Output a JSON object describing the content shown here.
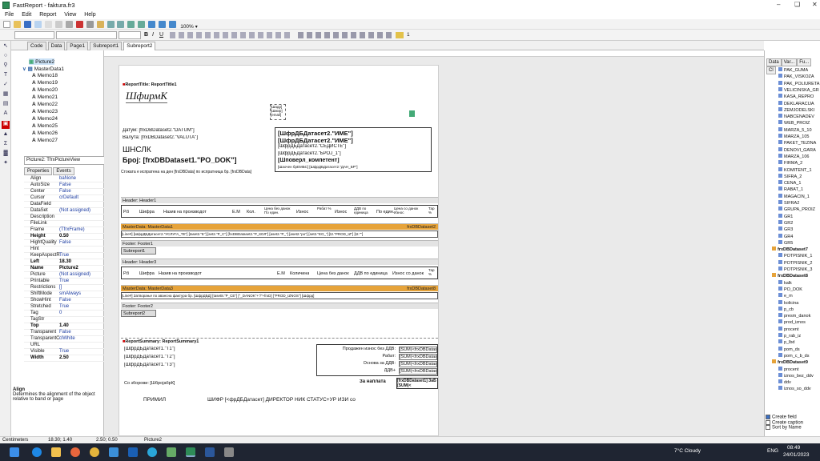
{
  "app": {
    "title": "FastReport - faktura.fr3"
  },
  "menu": [
    "File",
    "Edit",
    "Report",
    "View",
    "Help"
  ],
  "toolbar": {
    "zoom": "100%",
    "font_size": "1"
  },
  "tabs": [
    "Code",
    "Data",
    "Page1",
    "Subreport1",
    "Subreport2"
  ],
  "tree": [
    {
      "label": "Picture2",
      "sel": true
    },
    {
      "label": "MasterData1"
    },
    {
      "label": "Memo18"
    },
    {
      "label": "Memo19"
    },
    {
      "label": "Memo20"
    },
    {
      "label": "Memo21"
    },
    {
      "label": "Memo22"
    },
    {
      "label": "Memo23"
    },
    {
      "label": "Memo24"
    },
    {
      "label": "Memo25"
    },
    {
      "label": "Memo26"
    },
    {
      "label": "Memo27"
    }
  ],
  "object_selector": "Picture2: TfrxPictureView",
  "prop_tabs": [
    "Properties",
    "Events"
  ],
  "props": [
    {
      "k": "Align",
      "v": "baNone"
    },
    {
      "k": "AutoSize",
      "v": "False"
    },
    {
      "k": "Center",
      "v": "False"
    },
    {
      "k": "Cursor",
      "v": "crDefault"
    },
    {
      "k": "DataField",
      "v": ""
    },
    {
      "k": "DataSet",
      "v": "(Not assigned)"
    },
    {
      "k": "Description",
      "v": ""
    },
    {
      "k": "FileLink",
      "v": ""
    },
    {
      "k": "Frame",
      "v": "(TfrxFrame)"
    },
    {
      "k": "Height",
      "v": "0.50",
      "b": true
    },
    {
      "k": "HightQuality",
      "v": "False"
    },
    {
      "k": "Hint",
      "v": ""
    },
    {
      "k": "KeepAspectR",
      "v": "True"
    },
    {
      "k": "Left",
      "v": "18.30",
      "b": true
    },
    {
      "k": "Name",
      "v": "Picture2",
      "b": true
    },
    {
      "k": "Picture",
      "v": "(Not assigned)"
    },
    {
      "k": "Printable",
      "v": "True"
    },
    {
      "k": "Restrictions",
      "v": "[]"
    },
    {
      "k": "ShiftMode",
      "v": "smAlways"
    },
    {
      "k": "ShowHint",
      "v": "False"
    },
    {
      "k": "Stretched",
      "v": "True"
    },
    {
      "k": "Tag",
      "v": "0"
    },
    {
      "k": "TagStr",
      "v": ""
    },
    {
      "k": "Top",
      "v": "1.40",
      "b": true
    },
    {
      "k": "Transparent",
      "v": "False"
    },
    {
      "k": "TransparentC",
      "v": "clWhite"
    },
    {
      "k": "URL",
      "v": ""
    },
    {
      "k": "Visible",
      "v": "True"
    },
    {
      "k": "Width",
      "v": "2.50",
      "b": true
    }
  ],
  "help": {
    "title": "Align",
    "text": "Determines the alignment of the object relative to band or page"
  },
  "report": {
    "report_title": "ReportTitle: ReportTitle1",
    "logo_text": "ШфирмК",
    "fields_box": "[Шадр] [Шжир] [email]",
    "datum": "Датум: [frxDBDataset2.\"DATUM\"]",
    "valuta": "Валута: [frxDBDataset2.\"VALUTA\"]",
    "shnclk": "ШНСЛК",
    "broj": "Број: [frxDBDataset1.\"PO_DOK\"]",
    "rt_box1": "[ШфрДБДатасет2.\"ИМЕ\"]",
    "rt_box2": "[ШфрДБДатасет2.\"ИМЕ\"]",
    "rt_box3": "[ШфрДБДатасет2.\"СЕДИСТЕ\"]",
    "rt_box4": "[ШфрДБДатасет2.\"БРОЈ_1\"]",
    "rt_box5": "[Шповерл_компетент]",
    "rt_box6": "[Шаочен брЕМБС]   [ШфрДБДатасет2.\"ДАН_БР\"]",
    "stokata": "Стоката е испратена на ден [frxDBData] по испратница бр. [frxDBData]",
    "header1": "Header: Header1",
    "cols1": [
      "Р.б",
      "Шифра",
      "Назив на производот",
      "Е.М",
      "Кол.",
      "Цена без данок По един.",
      "Износ",
      "Рабат %",
      "Износ",
      "ДДВ по единица",
      "По един.",
      "Цена со данок Износ",
      "Тар %"
    ],
    "masterdata1": "MasterData: MasterData1",
    "masterdata1_ds": "frxDBDataset2",
    "md1_row": "[Line#] [ШфрДБДатасет2.\"УСЛУГА_ТЕ\"] [taset2.\"Е\"] [set2.\"Р_С\"] [frxDBDataset2.\"Р_КОЛ\"] [aset2.\"Р_\"] [aset2.\"po\"] [set2.\"ЕО_\"] [t2.\"PROD_IZ\"] [t2.\"\"]",
    "footer1": "Footer: Footer1",
    "subreport1": "Subreport1",
    "header3": "Header: Header3",
    "cols3": [
      "Р.б",
      "Шифра",
      "Назив на производот",
      "Е.М",
      "Количина",
      "Цена без данок",
      "ДДВ по единица",
      "Износ со данок",
      "Тар %"
    ],
    "masterdata3": "MasterData: MasterData3",
    "masterdata3_ds": "frxDBDataset8",
    "md3_row": "[Line#]   Затворање по авансна фактура бр.   [ШфрДБД] [taset8.\"Р_СЕ\"]   [\"_DANOK\"+\"/\"+frxD]   [\"PROD_IZNOS\"]   [Шфрд]",
    "footer2": "Footer: Footer2",
    "subreport2": "Subreport2",
    "summary": "ReportSummary: ReportSummary1",
    "sum_l1": "[ШфрДБДатасет1.\"Т1\"]",
    "sum_l2": "[ШфрДБДатасет1.\"Т2\"]",
    "sum_l3": "[ШфрДБДатасет1.\"Т3\"]",
    "sum_r1": "Продажен износ без ДДВ:",
    "sum_r2": "Рабат:",
    "sum_r3": "Основа за ДДВ:",
    "sum_r4": "ДДВ+",
    "sum_v1": "[SUM(<frxDBDatas",
    "sum_v2": "[SUM(<frxDBDatas",
    "sum_v3": "[SUM(<frxDBDatas",
    "sum_v4": "[SUM(<frxDBDatas",
    "za_naplata": "За наплата",
    "naplata_val": "[frxDBDataset1] ЗаБ [SUM(<",
    "so_zborovi": "Со зборови: [ШбројабрК]",
    "primil": "ПРИМИЛ",
    "footer_line": "ШИФР [<фрДБДатасет]  ДИРЕКТОР НИК СТАТУС+УР ИЗИ со"
  },
  "right_panel": {
    "tabs": [
      "Data",
      "Var...",
      "Fu...",
      "Cl"
    ],
    "items": [
      {
        "t": "PAK_GUMA"
      },
      {
        "t": "PAK_VISKOZA"
      },
      {
        "t": "PAK_POLIURETA"
      },
      {
        "t": "VELICINSKA_GR"
      },
      {
        "t": "KASA_REPRO"
      },
      {
        "t": "DEKLARACIJA"
      },
      {
        "t": "ZEMJODELSKI"
      },
      {
        "t": "NABCENADEV"
      },
      {
        "t": "WEB_PROIZ"
      },
      {
        "t": "MARZA_5_10"
      },
      {
        "t": "MARZA_105"
      },
      {
        "t": "PAKET_TEZINA"
      },
      {
        "t": "DENOVI_GARA"
      },
      {
        "t": "MARZA_106"
      },
      {
        "t": "FIRMA_2"
      },
      {
        "t": "KOMITENT_1"
      },
      {
        "t": "SIFRA_2"
      },
      {
        "t": "CENA_1"
      },
      {
        "t": "RABAT_1"
      },
      {
        "t": "MAGACIN_1"
      },
      {
        "t": "SIFRA2"
      },
      {
        "t": "GRUPA_PROIZ"
      },
      {
        "t": "GR1"
      },
      {
        "t": "GR2"
      },
      {
        "t": "GR3"
      },
      {
        "t": "GR4"
      },
      {
        "t": "GR5"
      },
      {
        "t": "frxDBDataset7",
        "ds": true
      },
      {
        "t": "POTPISNIK_1"
      },
      {
        "t": "POTPISNIK_2"
      },
      {
        "t": "POTPISNIK_3"
      },
      {
        "t": "frxDBDataset8",
        "ds": true
      },
      {
        "t": "kalk"
      },
      {
        "t": "PO_DOK"
      },
      {
        "t": "e_m"
      },
      {
        "t": "kolicina"
      },
      {
        "t": "p_cb"
      },
      {
        "t": "presm_danok"
      },
      {
        "t": "prod_iznos"
      },
      {
        "t": "procent"
      },
      {
        "t": "p_rab_iz"
      },
      {
        "t": "p_lbd"
      },
      {
        "t": "pom_ds"
      },
      {
        "t": "pom_c_b_ds"
      },
      {
        "t": "frxDBDataset9",
        "ds": true
      },
      {
        "t": "procent"
      },
      {
        "t": "iznos_bez_ddv"
      },
      {
        "t": "ddv"
      },
      {
        "t": "iznos_so_ddv"
      }
    ],
    "opts": [
      "Create field",
      "Create caption",
      "Sort by Name"
    ]
  },
  "status": {
    "unit": "Centimeters",
    "pos": "18.30; 1.40",
    "size": "2.50; 0.50",
    "obj": "Picture2"
  },
  "taskbar": {
    "weather": "7°C Cloudy",
    "lang": "ENG",
    "time": "08:49",
    "date": "24/01/2023"
  }
}
